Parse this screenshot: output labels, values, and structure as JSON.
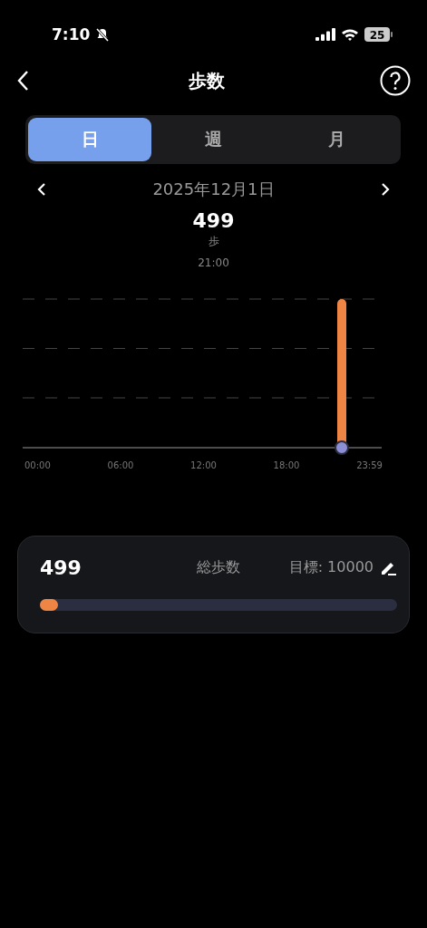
{
  "status_bar": {
    "time": "7:10",
    "silent": true,
    "battery": "25"
  },
  "header": {
    "title": "歩数"
  },
  "tabs": [
    {
      "label": "日",
      "selected": true
    },
    {
      "label": "週",
      "selected": false
    },
    {
      "label": "月",
      "selected": false
    }
  ],
  "date_nav": {
    "date": "2025年12月1日"
  },
  "tooltip": {
    "value": "499",
    "unit": "歩",
    "time": "21:00"
  },
  "chart": {
    "x_labels": [
      "00:00",
      "06:00",
      "12:00",
      "18:00",
      "23:59"
    ]
  },
  "summary": {
    "steps": "499",
    "label": "総歩数",
    "goal": "目標: 10000",
    "level": 0.05
  }
}
